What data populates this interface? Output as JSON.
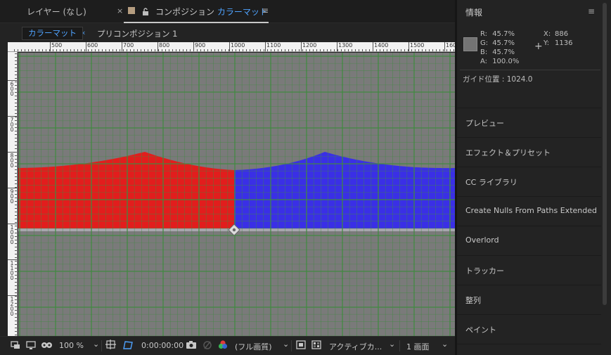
{
  "tabs": {
    "layer_tab": "レイヤー (なし)",
    "close_glyph": "×",
    "comp_prefix": "コンポジション",
    "comp_name": "カラーマット",
    "menu_glyph": "≡",
    "swatch_color": "#b59d80"
  },
  "flowchart": {
    "active_comp": "カラーマット",
    "chevron": "‹",
    "precomp": "プリコンポジション 1"
  },
  "rulers": {
    "top_labels": [
      "500",
      "600",
      "700",
      "800",
      "900",
      "1000",
      "1100",
      "1200",
      "1300",
      "1400",
      "1500",
      "1600"
    ],
    "left_labels": [
      "600",
      "700",
      "800",
      "900",
      "1000",
      "1100",
      "1200"
    ]
  },
  "viewer": {
    "background_color": "#7a7a7a",
    "grid_color": "#3f8a3f",
    "red_color": "#e21d1d",
    "blue_color": "#3a2fe6",
    "band_color": "#a7a6ad"
  },
  "footer": {
    "zoom": "100 %",
    "timecode": "0:00:00:00",
    "resolution": "(フル画質)",
    "camera": "アクティブカ...",
    "views": "1 画面",
    "chevron": "⌄"
  },
  "info": {
    "title": "情報",
    "menu_glyph": "≡",
    "swatch_color": "#747474",
    "r_label": "R:",
    "r_value": "45.7%",
    "g_label": "G:",
    "g_value": "45.7%",
    "b_label": "B:",
    "b_value": "45.7%",
    "a_label": "A:",
    "a_value": "100.0%",
    "x_label": "X:",
    "x_value": "886",
    "y_label": "Y:",
    "y_value": "1136",
    "crosshair": "+",
    "guide_position": "ガイド位置 : 1024.0"
  },
  "panels": [
    "プレビュー",
    "エフェクト＆プリセット",
    "CC ライブラリ",
    "Create Nulls From Paths Extended",
    "Overlord",
    "トラッカー",
    "整列",
    "ペイント"
  ]
}
